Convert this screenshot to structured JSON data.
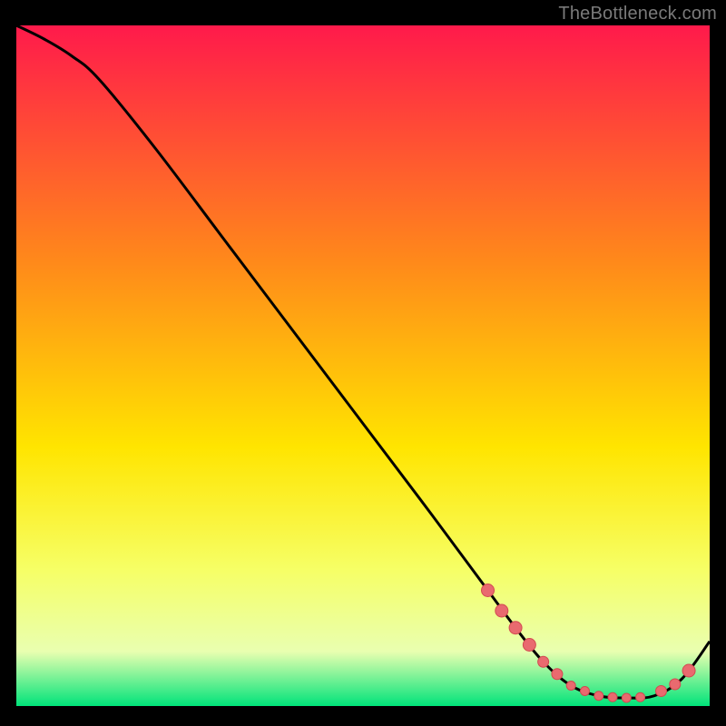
{
  "watermark": "TheBottleneck.com",
  "colors": {
    "bg_black": "#000000",
    "grad_top": "#ff1a4b",
    "grad_mid_top": "#ff8a1a",
    "grad_mid": "#ffe500",
    "grad_low": "#f6ff66",
    "grad_pale": "#e9ffb0",
    "grad_green": "#00e37a",
    "line": "#000000",
    "dot_fill": "#e96a6f",
    "dot_stroke": "#d24a50"
  },
  "chart_data": {
    "type": "line",
    "title": "",
    "xlabel": "",
    "ylabel": "",
    "xlim": [
      0,
      100
    ],
    "ylim": [
      0,
      100
    ],
    "series": [
      {
        "name": "curve",
        "x": [
          0,
          4,
          8,
          12,
          20,
          30,
          40,
          50,
          60,
          68,
          72,
          76,
          80,
          84,
          88,
          92,
          96,
          100
        ],
        "y": [
          100,
          98,
          95.5,
          92,
          82,
          68.5,
          55,
          41.5,
          28,
          17,
          11.5,
          6.5,
          3,
          1.5,
          1.2,
          1.5,
          4,
          9.5
        ]
      }
    ],
    "dots": {
      "comment": "salmon markers along the lower valley of the curve",
      "x": [
        68,
        70,
        72,
        74,
        76,
        78,
        80,
        82,
        84,
        86,
        88,
        90,
        93,
        95,
        97
      ],
      "y": [
        17,
        14,
        11.5,
        9,
        6.5,
        4.7,
        3,
        2.2,
        1.5,
        1.3,
        1.2,
        1.3,
        2.2,
        3.2,
        5.2
      ],
      "r": [
        7,
        7,
        7,
        7,
        6,
        6,
        5,
        5,
        5,
        5,
        5,
        5,
        6,
        6,
        7
      ]
    }
  }
}
